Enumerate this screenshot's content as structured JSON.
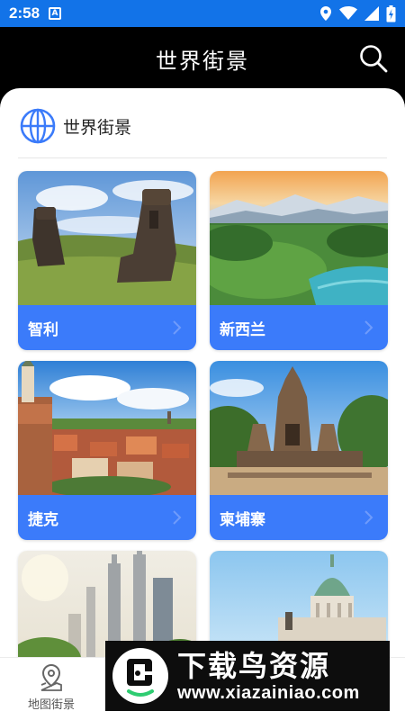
{
  "status": {
    "time": "2:58",
    "notif_badge": "A"
  },
  "appbar": {
    "title": "世界街景",
    "search_icon": "search-icon"
  },
  "section": {
    "label": "世界街景",
    "icon": "globe-icon"
  },
  "cards": [
    {
      "name": "智利"
    },
    {
      "name": "新西兰"
    },
    {
      "name": "捷克"
    },
    {
      "name": "柬埔寨"
    },
    {
      "name": ""
    },
    {
      "name": ""
    }
  ],
  "bottomnav": {
    "item_label": "地图街景",
    "icon": "map-pin-icon"
  },
  "watermark": {
    "title": "下载鸟资源",
    "url": "www.xiazainiao.com"
  },
  "colors": {
    "status_bar": "#1273e8",
    "card_bar": "#3b7bfa",
    "appbar": "#000000",
    "globe": "#3b7bfa"
  }
}
